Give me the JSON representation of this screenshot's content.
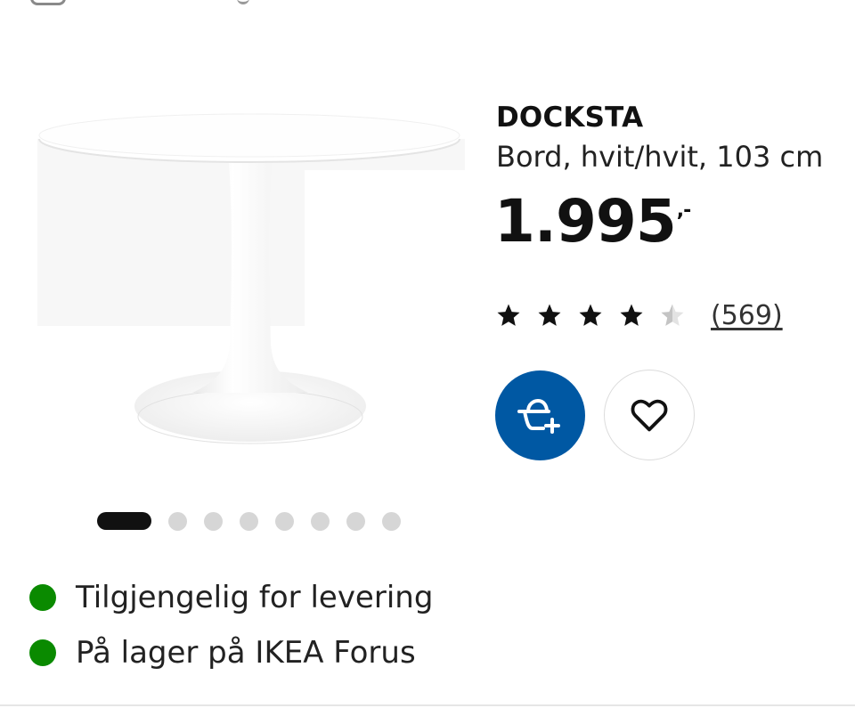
{
  "product": {
    "name": "DOCKSTA",
    "description": "Bord, hvit/hvit, 103 cm",
    "price": "1.995",
    "price_suffix": ",-",
    "rating": 4.5,
    "rating_max": 5,
    "review_count": "(569)"
  },
  "carousel": {
    "active_index": 0,
    "total": 8
  },
  "availability": [
    {
      "text": "Tilgjengelig for levering",
      "status_color": "#0a8a00"
    },
    {
      "text": "På lager på IKEA Forus",
      "status_color": "#0a8a00"
    }
  ],
  "icons": {
    "cart": "add-to-cart-icon",
    "favourite": "heart-icon",
    "rating": "star-icon"
  },
  "colors": {
    "accent": "#0058a3",
    "available": "#0a8a00"
  }
}
